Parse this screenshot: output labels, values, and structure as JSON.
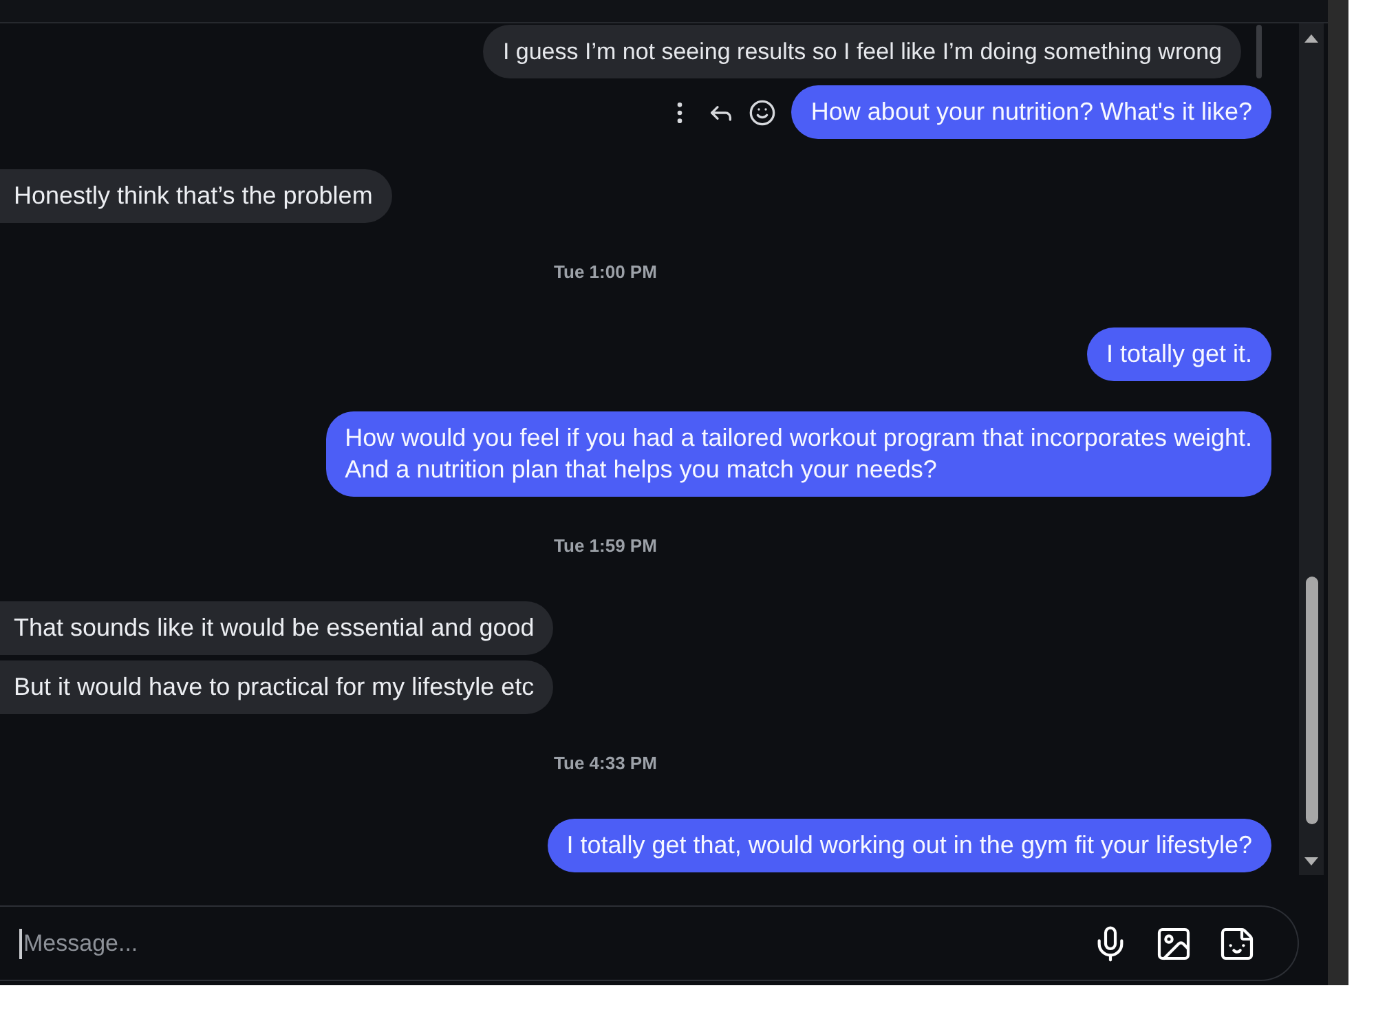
{
  "conversation": {
    "items": [
      {
        "kind": "message_group",
        "outgoing": true,
        "messages": [
          {
            "reply_quote": "I guess I’m not seeing results so I feel like I’m doing something wrong",
            "text": "How about your nutrition? What's it like?",
            "hovered": true
          }
        ]
      },
      {
        "kind": "message_group",
        "outgoing": false,
        "messages": [
          {
            "text": "Honestly think that’s the problem",
            "hovered": false
          }
        ]
      },
      {
        "kind": "timestamp",
        "text": "Tue 1:00 PM"
      },
      {
        "kind": "message_group",
        "outgoing": true,
        "messages": [
          {
            "text": "I totally get it.",
            "hovered": false
          }
        ]
      },
      {
        "kind": "message_group",
        "outgoing": true,
        "messages": [
          {
            "text": "How would you feel if you had a tailored workout program that incorporates weight.\nAnd a nutrition plan that helps you match your needs?",
            "hovered": false
          }
        ]
      },
      {
        "kind": "timestamp",
        "text": "Tue 1:59 PM"
      },
      {
        "kind": "message_group",
        "outgoing": false,
        "messages": [
          {
            "text": "That sounds like it would be essential and good",
            "hovered": false
          },
          {
            "text": "But it would have to practical for my lifestyle etc",
            "hovered": false
          }
        ]
      },
      {
        "kind": "timestamp",
        "text": "Tue 4:33 PM"
      },
      {
        "kind": "message_group",
        "outgoing": true,
        "messages": [
          {
            "text": "I totally get that, would working out in the gym fit your lifestyle?",
            "hovered": false
          }
        ]
      }
    ]
  },
  "composer": {
    "placeholder": "Message...",
    "focused": true
  }
}
